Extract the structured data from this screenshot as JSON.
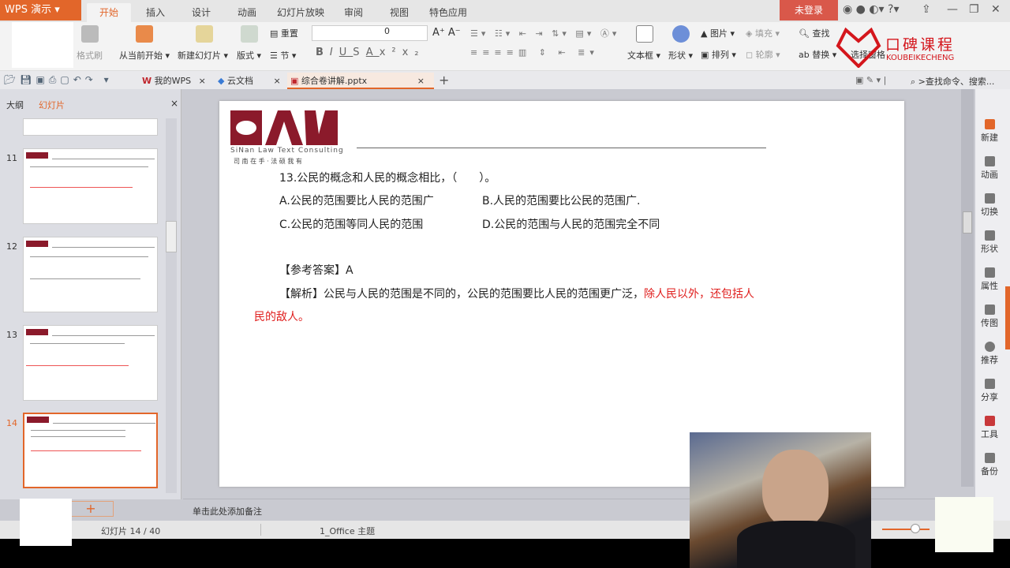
{
  "app": {
    "menu_button": "WPS 演示",
    "login": "未登录"
  },
  "menu_tabs": [
    "开始",
    "插入",
    "设计",
    "动画",
    "幻灯片放映",
    "审阅",
    "视图",
    "特色应用"
  ],
  "ribbon": {
    "format_painter": "格式刷",
    "from_current": "从当前开始",
    "new_slide": "新建幻灯片",
    "layout": "版式",
    "reset": "重置",
    "section": "节",
    "font_size": "0",
    "textbox": "文本框",
    "shape": "形状",
    "picture": "图片",
    "arrange": "排列",
    "fill": "填充",
    "outline": "轮廓",
    "find": "查找",
    "replace": "替换",
    "select_pane": "选择窗格",
    "search_placeholder": ">查找命令、搜索..."
  },
  "doc_tabs": [
    {
      "label": "我的WPS"
    },
    {
      "label": "云文档"
    },
    {
      "label": "综合卷讲解.pptx"
    }
  ],
  "panel": {
    "tab_outline": "大纲",
    "tab_slides": "幻灯片",
    "thumbs": [
      "11",
      "12",
      "13",
      "14"
    ]
  },
  "slide": {
    "logo_text": "SAW",
    "logo_sub": "SiNan Law Text Consulting",
    "logo_cn": "司 南 在 手 · 法 硕 我 有",
    "question": "13.公民的概念和人民的概念相比，（　　）。",
    "option_a": "A.公民的范围要比人民的范围广",
    "option_b": "B.人民的范围要比公民的范围广.",
    "option_c": "C.公民的范围等同人民的范围",
    "option_d": "D.公民的范围与人民的范围完全不同",
    "answer": "【参考答案】A",
    "analysis_black": "【解析】公民与人民的范围是不同的，公民的范围要比人民的范围更广泛，",
    "analysis_red1": "除人民以外，还包括人",
    "analysis_red2": "民的敌人。"
  },
  "notes_placeholder": "单击此处添加备注",
  "status": {
    "slide_count": "幻灯片 14 / 40",
    "theme": "1_Office 主题"
  },
  "right_sidebar": [
    "新建",
    "动画",
    "切换",
    "形状",
    "属性",
    "传图",
    "推荐",
    "分享",
    "工具",
    "备份"
  ],
  "watermark": {
    "title": "口碑课程",
    "sub": "KOUBEIKECHENG"
  },
  "colors": {
    "accent": "#e2662a",
    "login": "#d9584a",
    "answer_red": "#e0201f",
    "logo": "#8b1a2b"
  }
}
